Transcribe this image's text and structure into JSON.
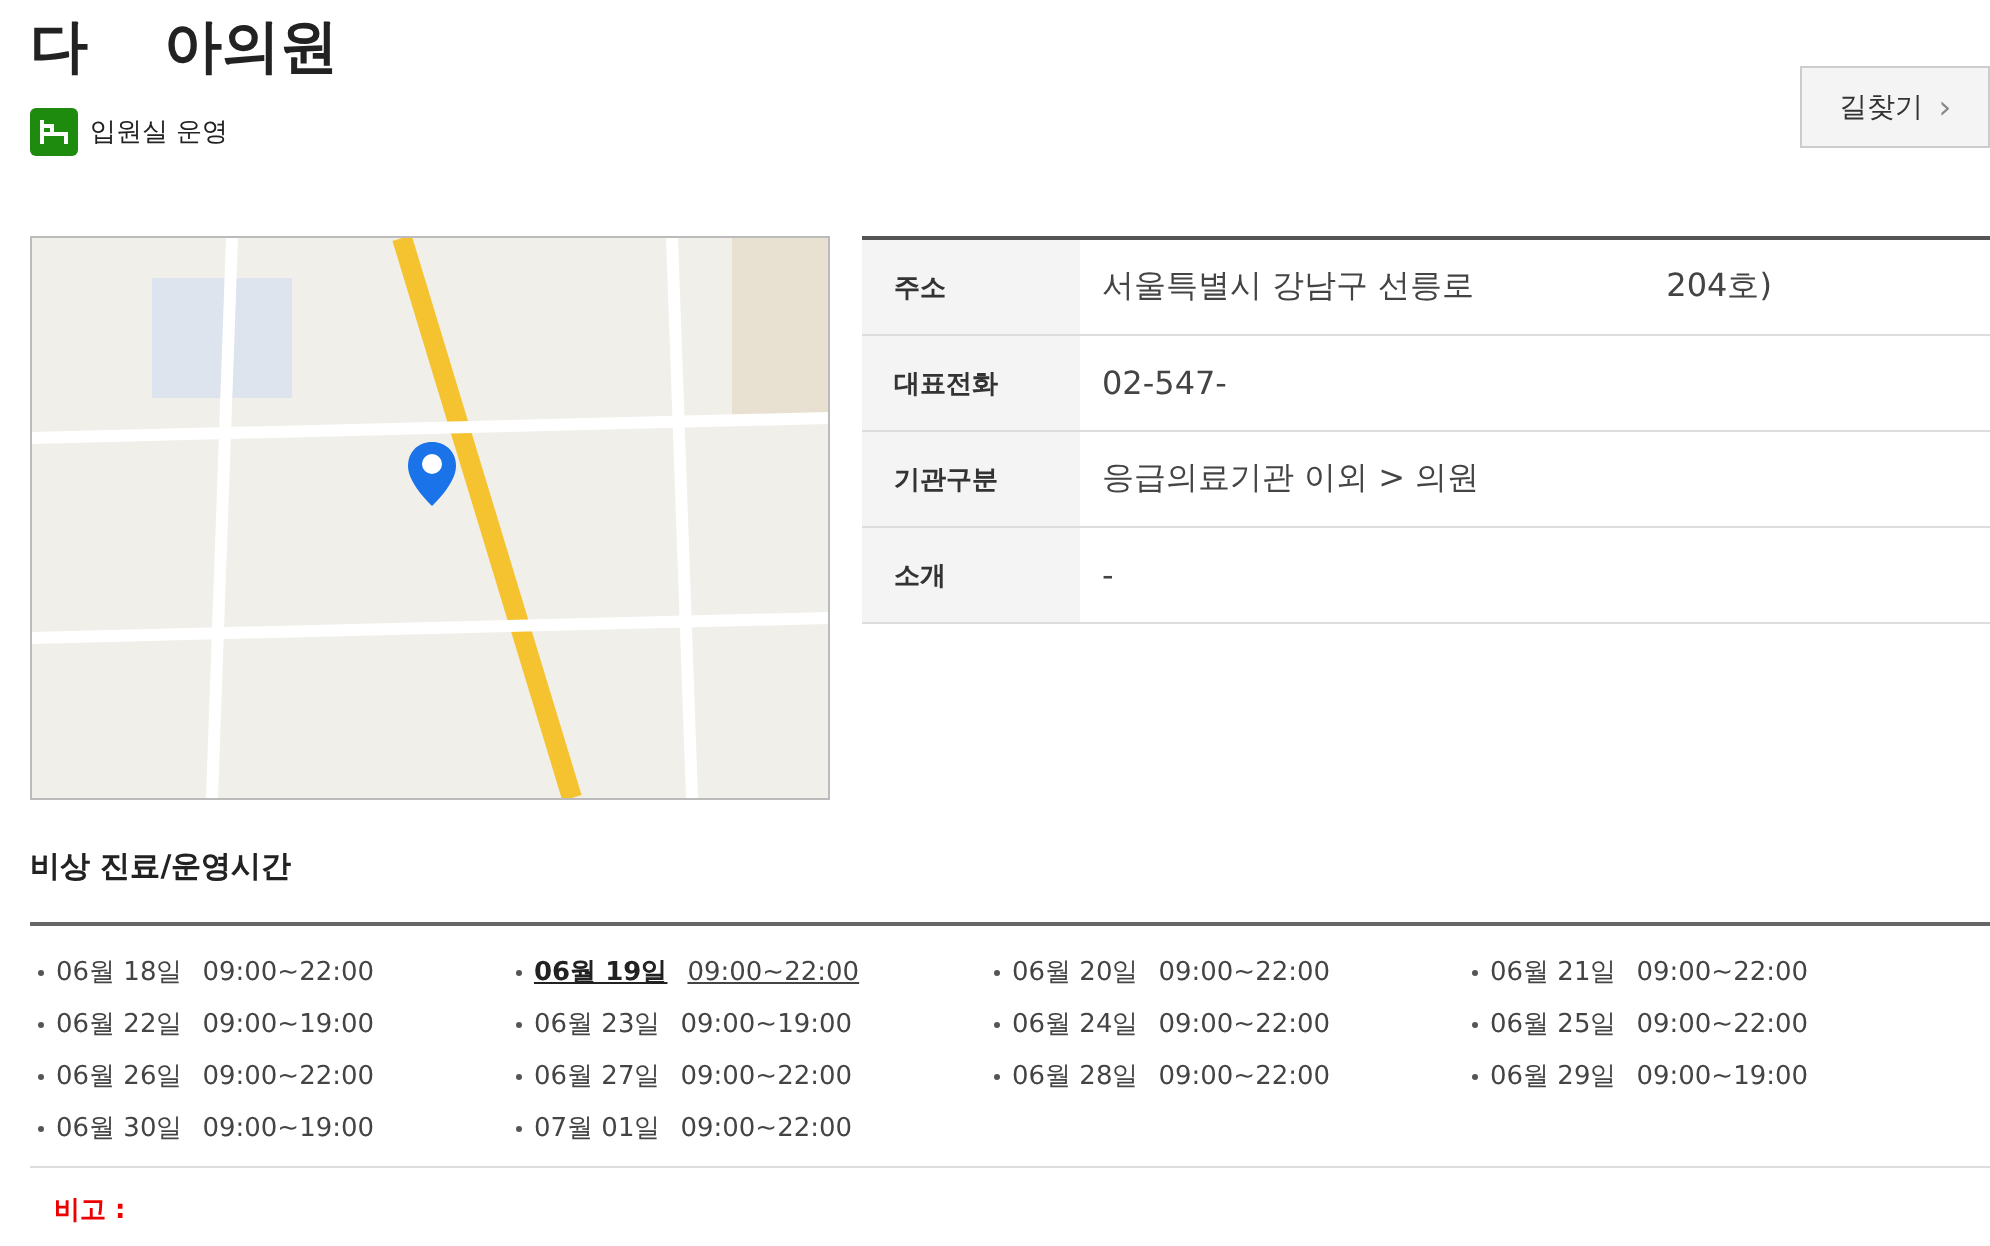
{
  "title": {
    "part_1": "다",
    "part_2": "아의원"
  },
  "badge": {
    "label": "입원실 운영"
  },
  "directions_button": {
    "label": "길찾기",
    "arrow": "›"
  },
  "info_table": [
    {
      "label": "주소",
      "values": [
        "서울특별시 강남구 선릉로",
        "204호)"
      ]
    },
    {
      "label": "대표전화",
      "values": [
        "02-547-"
      ]
    },
    {
      "label": "기관구분",
      "values": [
        "응급의료기관 이외 > 의원"
      ]
    },
    {
      "label": "소개",
      "values": [
        "-"
      ]
    }
  ],
  "schedule": {
    "title": "비상 진료/운영시간",
    "days": [
      {
        "date": "06월 18일",
        "hours": "09:00~22:00",
        "selected": false
      },
      {
        "date": "06월 19일",
        "hours": "09:00~22:00",
        "selected": true
      },
      {
        "date": "06월 20일",
        "hours": "09:00~22:00",
        "selected": false
      },
      {
        "date": "06월 21일",
        "hours": "09:00~22:00",
        "selected": false
      },
      {
        "date": "06월 22일",
        "hours": "09:00~19:00",
        "selected": false
      },
      {
        "date": "06월 23일",
        "hours": "09:00~19:00",
        "selected": false
      },
      {
        "date": "06월 24일",
        "hours": "09:00~22:00",
        "selected": false
      },
      {
        "date": "06월 25일",
        "hours": "09:00~22:00",
        "selected": false
      },
      {
        "date": "06월 26일",
        "hours": "09:00~22:00",
        "selected": false
      },
      {
        "date": "06월 27일",
        "hours": "09:00~22:00",
        "selected": false
      },
      {
        "date": "06월 28일",
        "hours": "09:00~22:00",
        "selected": false
      },
      {
        "date": "06월 29일",
        "hours": "09:00~19:00",
        "selected": false
      },
      {
        "date": "06월 30일",
        "hours": "09:00~19:00",
        "selected": false
      },
      {
        "date": "07월 01일",
        "hours": "09:00~22:00",
        "selected": false
      }
    ],
    "note_label": "비고 :"
  }
}
